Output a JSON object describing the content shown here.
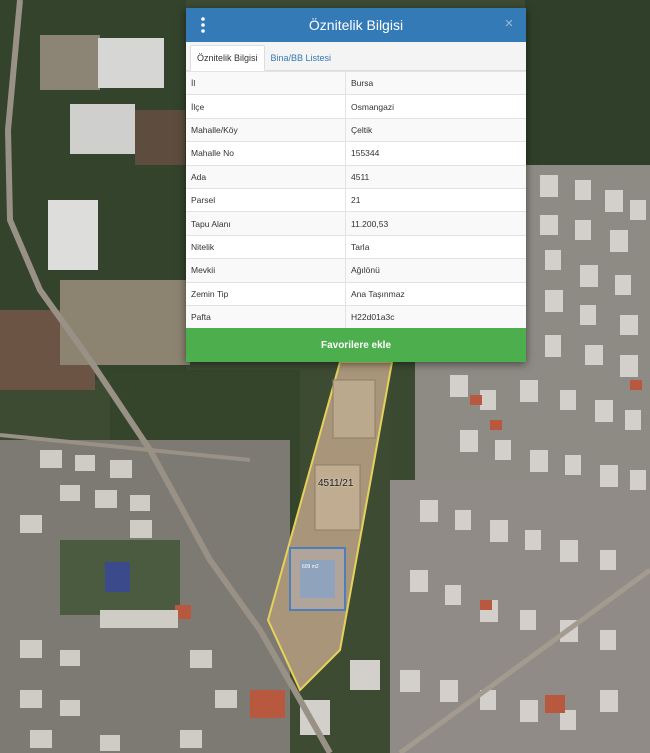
{
  "panel": {
    "title": "Öznitelik Bilgisi",
    "close_glyph": "×",
    "menu_icon": "vertical-dots-icon",
    "close_icon": "close-icon"
  },
  "tabs": [
    {
      "label": "Öznitelik Bilgisi",
      "active": true
    },
    {
      "label": "Bina/BB Listesi",
      "active": false
    }
  ],
  "attributes": [
    {
      "key": "İl",
      "value": "Bursa"
    },
    {
      "key": "İlçe",
      "value": "Osmangazi"
    },
    {
      "key": "Mahalle/Köy",
      "value": "Çeltik"
    },
    {
      "key": "Mahalle No",
      "value": "155344"
    },
    {
      "key": "Ada",
      "value": "4511"
    },
    {
      "key": "Parsel",
      "value": "21"
    },
    {
      "key": "Tapu Alanı",
      "value": "11.200,53"
    },
    {
      "key": "Nitelik",
      "value": "Tarla"
    },
    {
      "key": "Mevkii",
      "value": "Ağılönü"
    },
    {
      "key": "Zemin Tip",
      "value": "Ana Taşınmaz"
    },
    {
      "key": "Pafta",
      "value": "H22d01a3c"
    }
  ],
  "favorite_button": {
    "label": "Favorilere ekle"
  },
  "map": {
    "parcel_label": "4511/21",
    "area_label": "609 m2",
    "parcel_outline_color": "#e6d25a",
    "accent_color": "#337ab7",
    "button_color": "#4cae4c"
  }
}
